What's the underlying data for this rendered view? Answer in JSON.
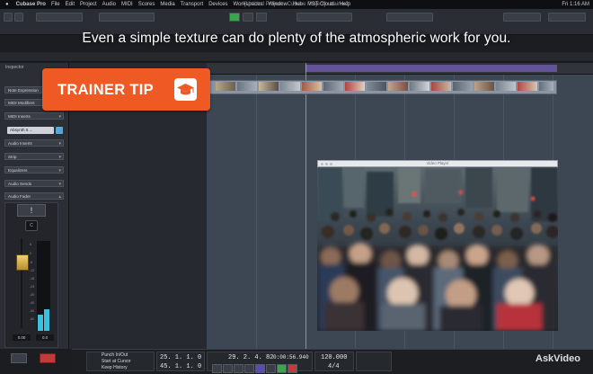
{
  "menubar": {
    "app": "Cubase Pro",
    "items": [
      "File",
      "Edit",
      "Project",
      "Audio",
      "MIDI",
      "Scores",
      "Media",
      "Transport",
      "Devices",
      "Workspaces",
      "Window",
      "Hub",
      "VST Cloud",
      "Help"
    ],
    "window_title": "[Untitled Project - Cubase Project] - trainer2",
    "right": "Fri 1:16 AM"
  },
  "caption": "Even a simple texture can do plenty of the atmospheric work for you.",
  "trainer_tip": {
    "label": "TRAINER TIP",
    "icon": "graduation-cap-icon",
    "color": "#ef5a24"
  },
  "inspector": {
    "title": "Inspector",
    "sections": [
      "Note Expression",
      "MIDI Modifiers",
      "MIDI Inserts",
      "Audio Inserts",
      "Strip",
      "Equalizers",
      "Audio Sends",
      "Audio Fader"
    ],
    "instrument": "Absynth 5 ...",
    "read_write": "!",
    "pan": "C",
    "fader_left_value": "0.00",
    "fader_right_value": "0.0",
    "scale": [
      "6",
      "0",
      "-6",
      "-12",
      "-18",
      "-24",
      "-30",
      "-40",
      "-50",
      "-60"
    ],
    "meter_color": "#3cc0e0"
  },
  "video_player": {
    "title": "Video Player"
  },
  "transport": {
    "pre_roll": [
      "Punch In/Out",
      "Start at Cursor",
      "Keep History"
    ],
    "left_locator": "25. 1. 1. 0",
    "right_locator": "45. 1. 1. 0",
    "position_bars": "29. 2. 4. 82",
    "position_time": "0:00:56.940",
    "tempo": "120.000",
    "signature": "4/4"
  },
  "watermark": "AskVideo"
}
